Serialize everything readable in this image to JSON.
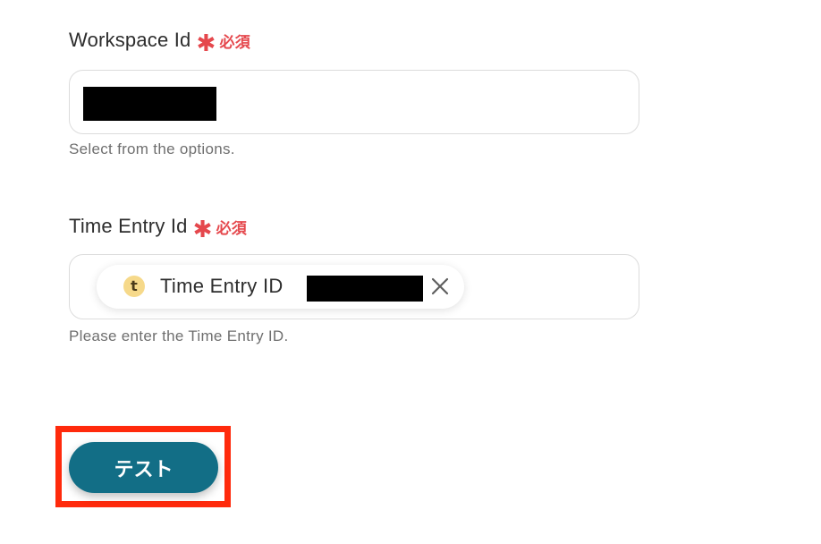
{
  "fields": [
    {
      "label": "Workspace Id",
      "required_mark": "✱",
      "required_text": "必須",
      "value": "[redacted]",
      "helper": "Select from the options."
    },
    {
      "label": "Time Entry Id",
      "required_mark": "✱",
      "required_text": "必須",
      "chip": {
        "icon_letter": "t",
        "icon_name": "toggl-track-icon",
        "label": "Time Entry ID",
        "value": "[redacted]",
        "close_icon": "close-icon"
      },
      "helper": "Please enter the Time Entry ID."
    }
  ],
  "actions": {
    "test_label": "テスト"
  },
  "colors": {
    "required": "#e5484d",
    "button": "#126e86",
    "highlight": "#ff2a0c",
    "chip_icon": "#f6d98a"
  }
}
